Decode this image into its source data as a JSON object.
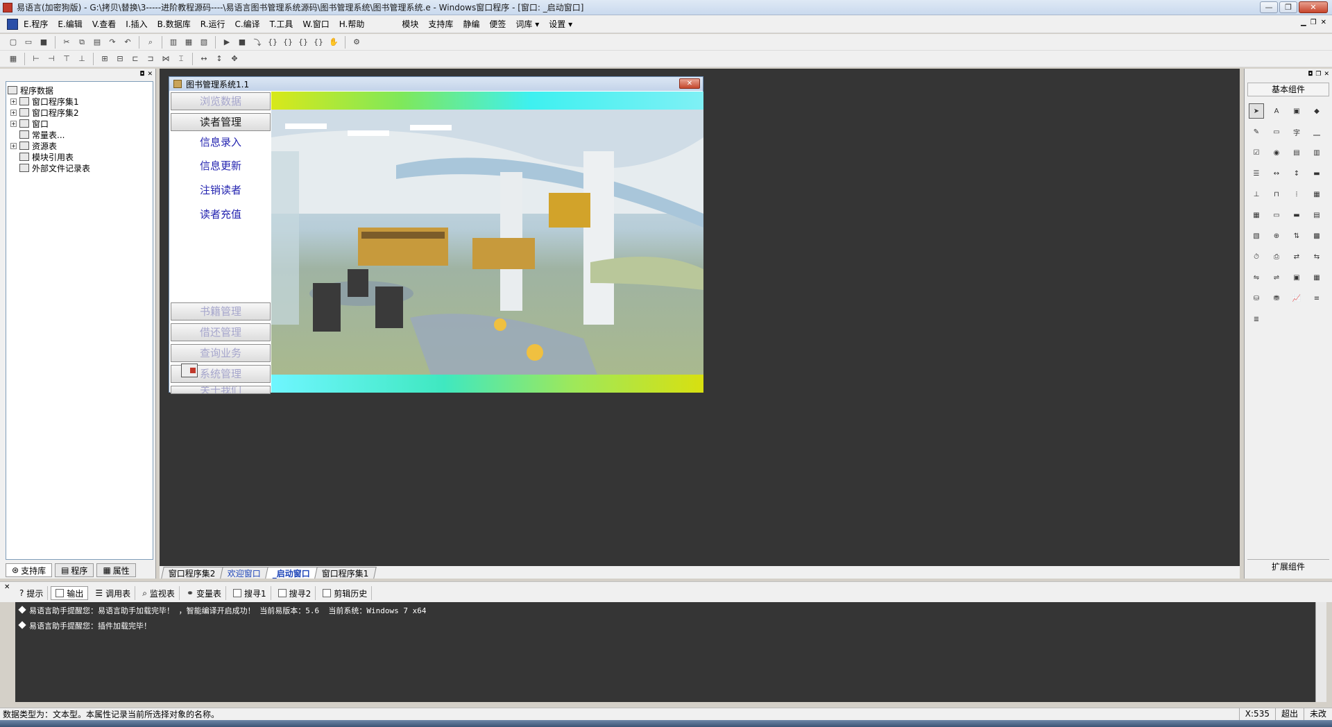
{
  "window": {
    "title": "易语言(加密狗版) - G:\\拷贝\\替换\\3-----进阶教程源码----\\易语言图书管理系统源码\\图书管理系统\\图书管理系统.e - Windows窗口程序 - [窗口: _启动窗口]",
    "btn_min": "—",
    "btn_max": "❐",
    "btn_close": "✕"
  },
  "menu": {
    "items": [
      "E.程序",
      "E.编辑",
      "V.查看",
      "I.插入",
      "B.数据库",
      "R.运行",
      "C.编译",
      "T.工具",
      "W.窗口",
      "H.帮助"
    ],
    "extra": [
      "模块",
      "支持库",
      "静编",
      "便签",
      "词库 ▾",
      "设置 ▾"
    ]
  },
  "left_panel": {
    "tree": [
      {
        "label": "程序数据",
        "expander": "",
        "indent": 0
      },
      {
        "label": "窗口程序集1",
        "expander": "+",
        "indent": 1
      },
      {
        "label": "窗口程序集2",
        "expander": "+",
        "indent": 1
      },
      {
        "label": "窗口",
        "expander": "+",
        "indent": 1
      },
      {
        "label": "常量表...",
        "expander": "",
        "indent": 1
      },
      {
        "label": "资源表",
        "expander": "+",
        "indent": 1
      },
      {
        "label": "模块引用表",
        "expander": "",
        "indent": 1
      },
      {
        "label": "外部文件记录表",
        "expander": "",
        "indent": 1
      }
    ],
    "tabs": [
      "支持库",
      "程序",
      "属性"
    ]
  },
  "child_window": {
    "title": "图书管理系统1.1",
    "nav": {
      "browse": "浏览数据",
      "reader_mgmt": "读者管理",
      "info_entry": "信息录入",
      "info_update": "信息更新",
      "cancel_reader": "注销读者",
      "reader_recharge": "读者充值",
      "book_mgmt": "书籍管理",
      "borrow_return": "借还管理",
      "query": "查询业务",
      "system_mgmt": "系统管理",
      "about": "关于我们"
    }
  },
  "right_panel": {
    "title": "基本组件",
    "bottom": "扩展组件"
  },
  "file_tabs": [
    "窗口程序集2",
    "欢迎窗口",
    "_启动窗口",
    "窗口程序集1"
  ],
  "output_tabs": [
    "提示",
    "输出",
    "调用表",
    "监视表",
    "变量表",
    "搜寻1",
    "搜寻2",
    "剪辑历史"
  ],
  "output_lines": [
    "易语言助手提醒您：易语言助手加载完毕！ ，智能编译开启成功！ 当前易版本：5.6  当前系统：Windows 7 x64",
    "易语言助手提醒您：插件加载完毕！"
  ],
  "status": {
    "message": "数据类型为：文本型。本属性记录当前所选择对象的名称。",
    "coord": "X:535",
    "mode": "超出",
    "extra": "未改"
  }
}
